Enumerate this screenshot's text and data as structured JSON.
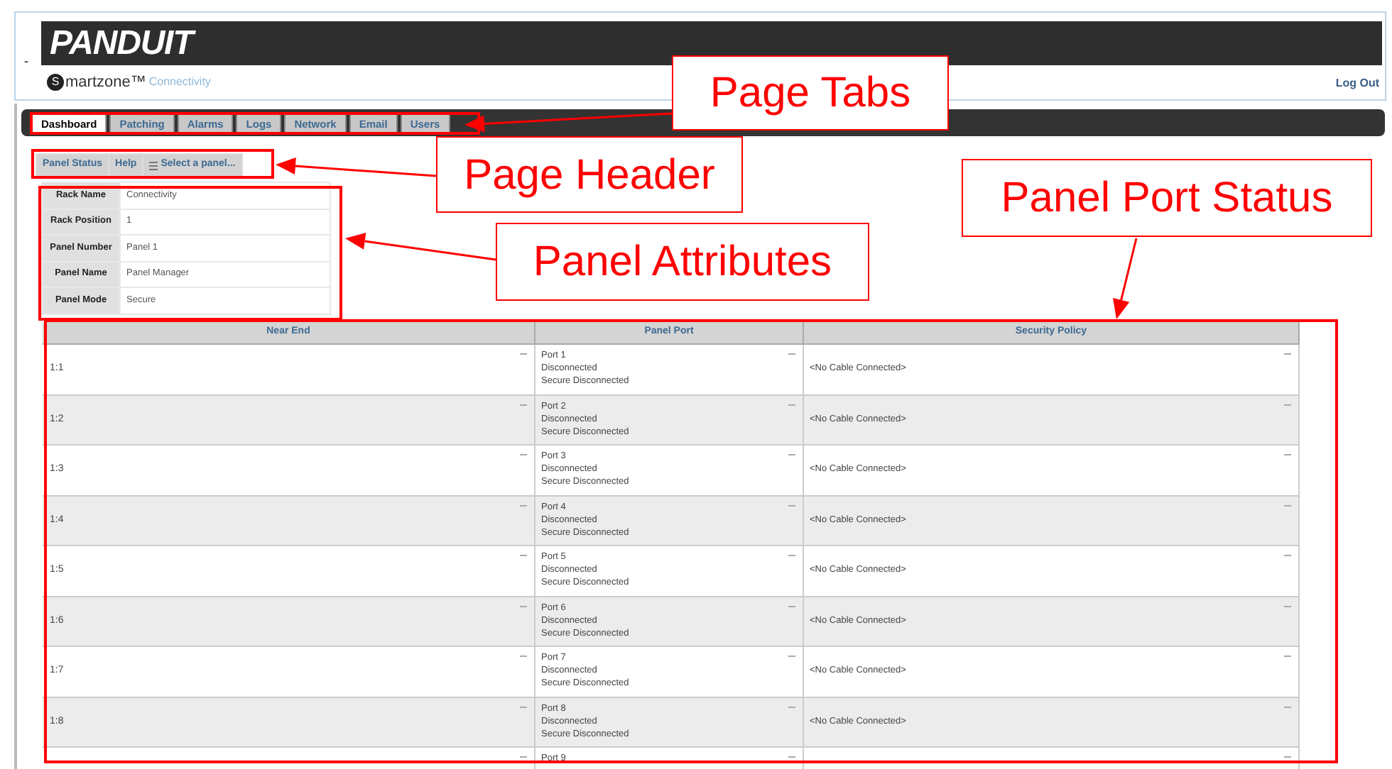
{
  "header": {
    "collapse_mark": "-",
    "logo": "PANDUIT",
    "brand_initial": "S",
    "brand_name": "martzone™",
    "brand_product": "Connectivity",
    "logout": "Log Out"
  },
  "tabs": [
    {
      "label": "Dashboard",
      "selected": true
    },
    {
      "label": "Patching",
      "selected": false
    },
    {
      "label": "Alarms",
      "selected": false
    },
    {
      "label": "Logs",
      "selected": false
    },
    {
      "label": "Network",
      "selected": false
    },
    {
      "label": "Email",
      "selected": false
    },
    {
      "label": "Users",
      "selected": false
    }
  ],
  "page_header": {
    "buttons": [
      {
        "label": "Panel Status",
        "kind": "plain"
      },
      {
        "label": "Help",
        "kind": "plain"
      },
      {
        "label": "Select a panel...",
        "kind": "menu"
      }
    ]
  },
  "panel_attributes": [
    {
      "label": "Rack Name",
      "value": "Connectivity"
    },
    {
      "label": "Rack Position",
      "value": "1"
    },
    {
      "label": "Panel Number",
      "value": "Panel 1"
    },
    {
      "label": "Panel Name",
      "value": "Panel Manager"
    },
    {
      "label": "Panel Mode",
      "value": "Secure"
    }
  ],
  "port_table": {
    "columns": [
      "Near End",
      "Panel Port",
      "Security Policy"
    ],
    "rows": [
      {
        "near_end": "1:1",
        "panel_port": [
          "Port 1",
          "Disconnected",
          "Secure Disconnected"
        ],
        "security_policy": "<No Cable Connected>"
      },
      {
        "near_end": "1:2",
        "panel_port": [
          "Port 2",
          "Disconnected",
          "Secure Disconnected"
        ],
        "security_policy": "<No Cable Connected>"
      },
      {
        "near_end": "1:3",
        "panel_port": [
          "Port 3",
          "Disconnected",
          "Secure Disconnected"
        ],
        "security_policy": "<No Cable Connected>"
      },
      {
        "near_end": "1:4",
        "panel_port": [
          "Port 4",
          "Disconnected",
          "Secure Disconnected"
        ],
        "security_policy": "<No Cable Connected>"
      },
      {
        "near_end": "1:5",
        "panel_port": [
          "Port 5",
          "Disconnected",
          "Secure Disconnected"
        ],
        "security_policy": "<No Cable Connected>"
      },
      {
        "near_end": "1:6",
        "panel_port": [
          "Port 6",
          "Disconnected",
          "Secure Disconnected"
        ],
        "security_policy": "<No Cable Connected>"
      },
      {
        "near_end": "1:7",
        "panel_port": [
          "Port 7",
          "Disconnected",
          "Secure Disconnected"
        ],
        "security_policy": "<No Cable Connected>"
      },
      {
        "near_end": "1:8",
        "panel_port": [
          "Port 8",
          "Disconnected",
          "Secure Disconnected"
        ],
        "security_policy": "<No Cable Connected>"
      },
      {
        "panel_port": [
          "Port 9"
        ]
      }
    ]
  },
  "annotations": [
    {
      "text": "Page Tabs"
    },
    {
      "text": "Page Header"
    },
    {
      "text": "Panel Attributes"
    },
    {
      "text": "Panel Port Status"
    }
  ]
}
